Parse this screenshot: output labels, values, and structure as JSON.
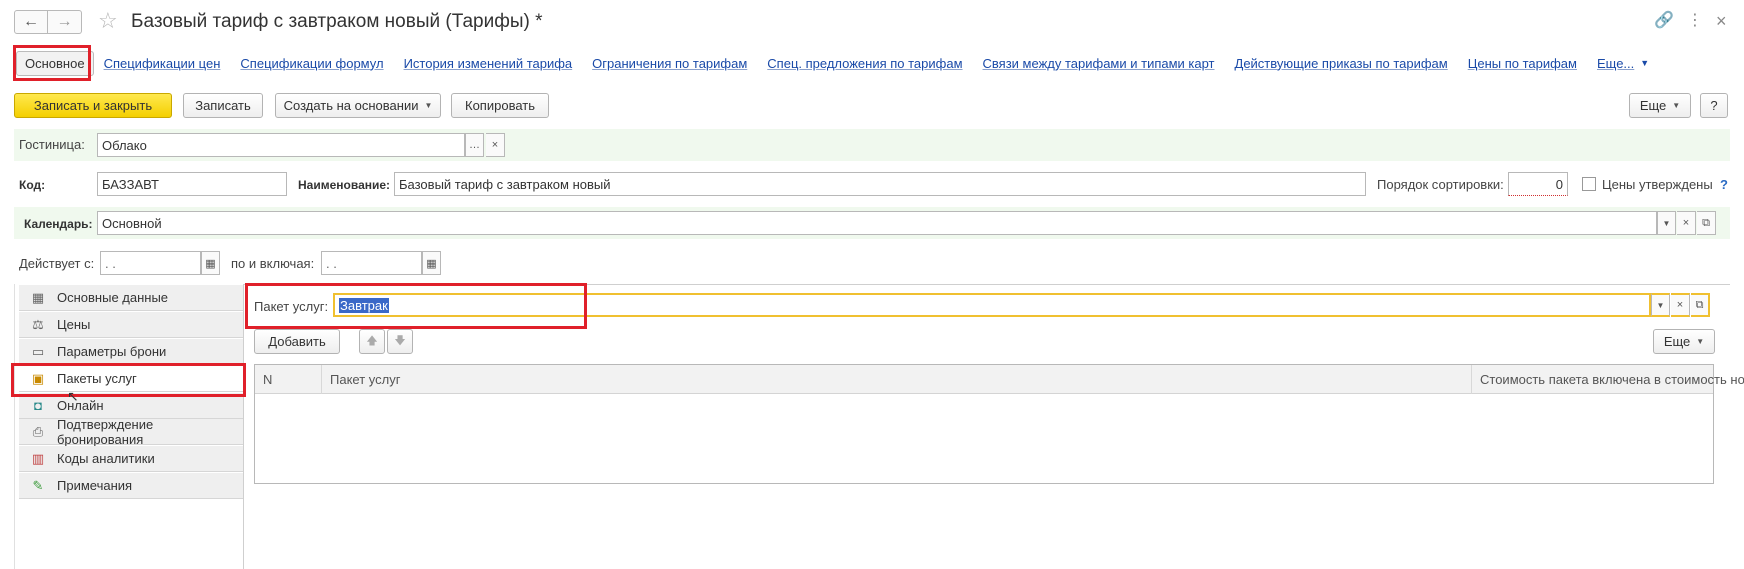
{
  "window": {
    "title": "Базовый тариф с завтраком новый (Тарифы) *",
    "back_icon": "←",
    "forward_icon": "→",
    "star_icon": "☆",
    "link_icon": "🔗",
    "menu_icon": "⋮",
    "close_icon": "×"
  },
  "tabs": {
    "active": "Основное",
    "links": [
      "Спецификации цен",
      "Спецификации формул",
      "История изменений тарифа",
      "Ограничения по тарифам",
      "Спец. предложения по тарифам",
      "Связи между тарифами и типами карт",
      "Действующие приказы по тарифам",
      "Цены по тарифам",
      "Еще..."
    ]
  },
  "toolbar": {
    "save_close": "Записать и закрыть",
    "save": "Записать",
    "create_based": "Создать на основании",
    "copy": "Копировать",
    "more": "Еще",
    "help": "?"
  },
  "form": {
    "hotel_label": "Гостиница:",
    "hotel_value": "Облако",
    "code_label": "Код:",
    "code_value": "БАЗЗАВТ",
    "name_label": "Наименование:",
    "name_value": "Базовый тариф с завтраком новый",
    "sort_label": "Порядок сортировки:",
    "sort_value": "0",
    "prices_approved_label": "Цены утверждены",
    "help_mark": "?",
    "calendar_label": "Календарь:",
    "calendar_value": "Основной",
    "valid_from_label": "Действует с:",
    "valid_from_value": " .  .",
    "valid_to_label": "по и включая:",
    "valid_to_value": " .  ."
  },
  "left_panel": {
    "items": [
      {
        "label": "Основные данные",
        "icon": "▦"
      },
      {
        "label": "Цены",
        "icon": "⚖"
      },
      {
        "label": "Параметры брони",
        "icon": "▭"
      },
      {
        "label": "Пакеты услуг",
        "icon": "▣"
      },
      {
        "label": "Онлайн",
        "icon": "◘"
      },
      {
        "label": "Подтверждение бронирования",
        "icon": "⎙"
      },
      {
        "label": "Коды аналитики",
        "icon": "▥"
      },
      {
        "label": "Примечания",
        "icon": "✎"
      }
    ]
  },
  "packages": {
    "label": "Пакет услуг:",
    "value": "Завтрак",
    "add_button": "Добавить",
    "up_icon": "🡅",
    "down_icon": "🡇",
    "more": "Еще",
    "columns": [
      "N",
      "Пакет услуг",
      "Стоимость пакета включена в стоимость номера"
    ]
  }
}
